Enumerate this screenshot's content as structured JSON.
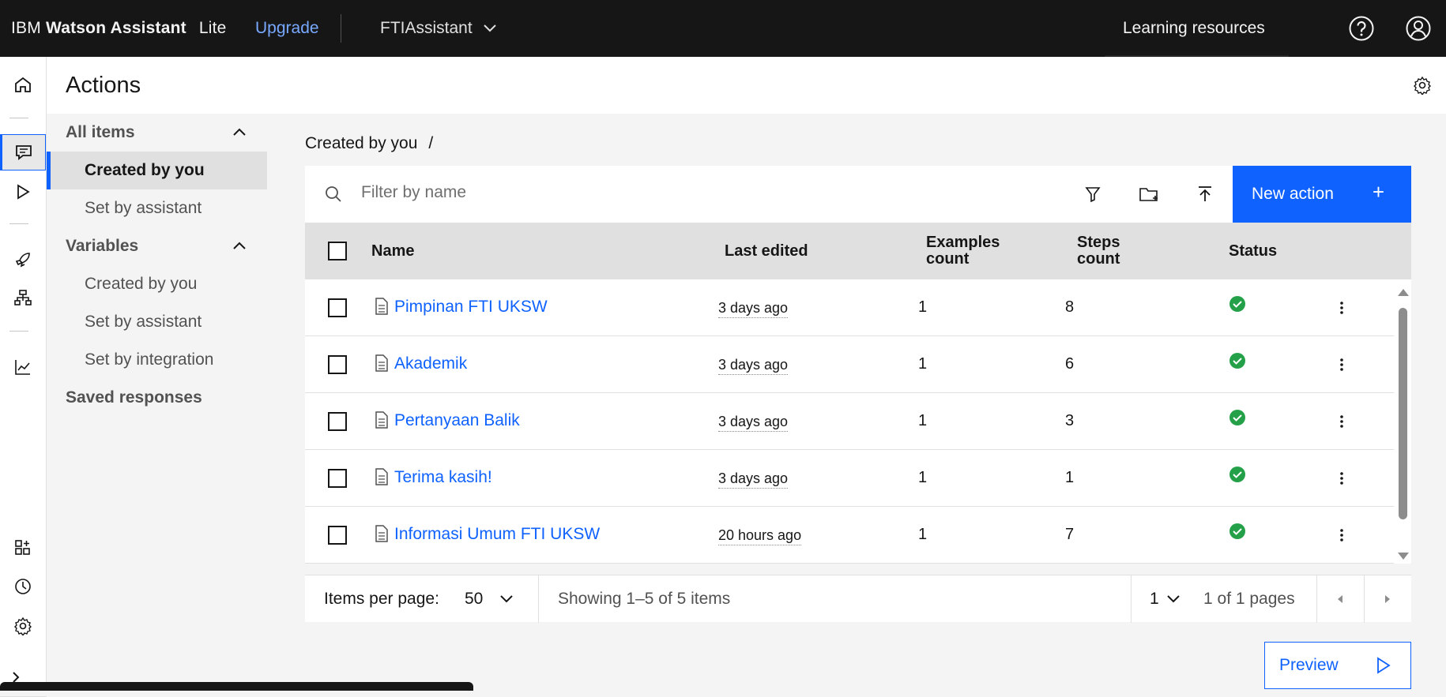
{
  "header": {
    "brand_prefix": "IBM",
    "brand_product": "Watson Assistant",
    "brand_plan": "Lite",
    "upgrade": "Upgrade",
    "assistant_name": "FTIAssistant",
    "learning_resources": "Learning resources",
    "icons": [
      "help-icon",
      "user-avatar-icon"
    ]
  },
  "rail": {
    "icons": [
      "home-icon",
      "actions-chat-icon",
      "preview-play-icon",
      "publish-rocket-icon",
      "environments-icon",
      "analytics-chart-icon",
      "integrations-icon",
      "history-icon",
      "settings-gear-icon",
      "expand-chevron-icon"
    ]
  },
  "page": {
    "title": "Actions"
  },
  "sidenav": {
    "all_items": "All items",
    "created_by_you": "Created by you",
    "set_by_assistant": "Set by assistant",
    "variables": "Variables",
    "var_created_by_you": "Created by you",
    "var_set_by_assistant": "Set by assistant",
    "var_set_by_integration": "Set by integration",
    "saved_responses": "Saved responses"
  },
  "breadcrumb": {
    "current": "Created by you",
    "separator": "/"
  },
  "toolbar": {
    "filter_placeholder": "Filter by name",
    "new_action": "New action",
    "new_action_plus": "+",
    "accent": "#0f62fe"
  },
  "table": {
    "headers": {
      "name": "Name",
      "last_edited": "Last edited",
      "examples_line1": "Examples",
      "examples_line2": "count",
      "steps_line1": "Steps",
      "steps_line2": "count",
      "status": "Status"
    },
    "rows": [
      {
        "name": "Pimpinan FTI UKSW",
        "last_edited": "3 days ago",
        "examples": "1",
        "steps": "8",
        "status": "ok"
      },
      {
        "name": "Akademik",
        "last_edited": "3 days ago",
        "examples": "1",
        "steps": "6",
        "status": "ok"
      },
      {
        "name": "Pertanyaan Balik",
        "last_edited": "3 days ago",
        "examples": "1",
        "steps": "3",
        "status": "ok"
      },
      {
        "name": "Terima kasih!",
        "last_edited": "3 days ago",
        "examples": "1",
        "steps": "1",
        "status": "ok"
      },
      {
        "name": "Informasi Umum FTI UKSW",
        "last_edited": "20 hours ago",
        "examples": "1",
        "steps": "7",
        "status": "ok"
      }
    ],
    "status_color": "#24a148"
  },
  "pagination": {
    "items_per_page_label": "Items per page:",
    "items_per_page": "50",
    "showing": "Showing 1–5 of 5 items",
    "page": "1",
    "of_pages": "1 of 1 pages"
  },
  "preview": {
    "label": "Preview"
  }
}
